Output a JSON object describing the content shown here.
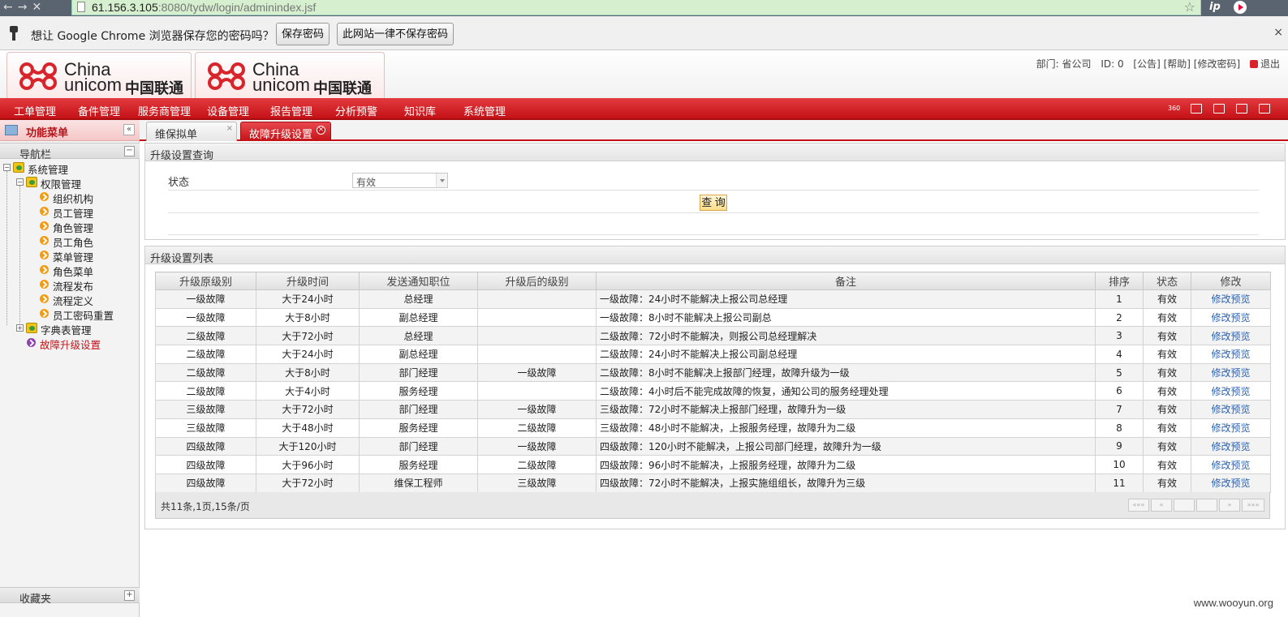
{
  "browser": {
    "url_host": "61.156.3.105",
    "url_rest": ":8080/tydw/login/adminindex.jsf",
    "ext_ip": "ip"
  },
  "infobar": {
    "message": "想让 Google Chrome 浏览器保存您的密码吗？",
    "save_label": "保存密码",
    "never_label": "此网站一律不保存密码",
    "close": "×"
  },
  "header": {
    "logo_en_1": "China",
    "logo_en_2": "unicom",
    "logo_cn": "中国联通",
    "dept": "部门: 省公司",
    "id": "ID: 0",
    "links": "[公告] [帮助] [修改密码]",
    "exit": "退出"
  },
  "menu": [
    "工单管理",
    "备件管理",
    "服务商管理",
    "设备管理",
    "报告管理",
    "分析预警",
    "知识库",
    "系统管理"
  ],
  "sidebar": {
    "title": "功能菜单",
    "collapse": "«",
    "nav_label": "导航栏",
    "nav_toggle": "−",
    "fav_label": "收藏夹",
    "fav_toggle": "+",
    "tree": {
      "root": "系统管理",
      "perm": "权限管理",
      "perm_items": [
        "组织机构",
        "员工管理",
        "角色管理",
        "员工角色",
        "菜单管理",
        "角色菜单",
        "流程发布",
        "流程定义",
        "员工密码重置"
      ],
      "dict": "字典表管理",
      "fault": "故障升级设置"
    }
  },
  "tabs": [
    {
      "label": "维保拟单",
      "close": "×"
    },
    {
      "label": "故障升级设置",
      "close": "×"
    }
  ],
  "query_panel": {
    "title": "升级设置查询",
    "status_label": "状态",
    "status_value": "有效",
    "query_button": "查 询"
  },
  "list_panel": {
    "title": "升级设置列表",
    "columns": [
      "升级原级别",
      "升级时间",
      "发送通知职位",
      "升级后的级别",
      "备注",
      "排序",
      "状态",
      "修改"
    ],
    "rows": [
      {
        "from": "一级故障",
        "time": "大于24小时",
        "notify": "总经理",
        "to": "",
        "note": "一级故障：24小时不能解决上报公司总经理",
        "order": "1",
        "status": "有效",
        "action": "修改预览"
      },
      {
        "from": "一级故障",
        "time": "大于8小时",
        "notify": "副总经理",
        "to": "",
        "note": "一级故障：8小时不能解决上报公司副总",
        "order": "2",
        "status": "有效",
        "action": "修改预览"
      },
      {
        "from": "二级故障",
        "time": "大于72小时",
        "notify": "总经理",
        "to": "",
        "note": "二级故障：72小时不能解决，则报公司总经理解决",
        "order": "3",
        "status": "有效",
        "action": "修改预览"
      },
      {
        "from": "二级故障",
        "time": "大于24小时",
        "notify": "副总经理",
        "to": "",
        "note": "二级故障：24小时不能解决上报公司副总经理",
        "order": "4",
        "status": "有效",
        "action": "修改预览"
      },
      {
        "from": "二级故障",
        "time": "大于8小时",
        "notify": "部门经理",
        "to": "一级故障",
        "note": "二级故障：8小时不能解决上报部门经理，故障升级为一级",
        "order": "5",
        "status": "有效",
        "action": "修改预览"
      },
      {
        "from": "二级故障",
        "time": "大于4小时",
        "notify": "服务经理",
        "to": "",
        "note": "二级故障：4小时后不能完成故障的恢复，通知公司的服务经理处理",
        "order": "6",
        "status": "有效",
        "action": "修改预览"
      },
      {
        "from": "三级故障",
        "time": "大于72小时",
        "notify": "部门经理",
        "to": "一级故障",
        "note": "三级故障：72小时不能解决上报部门经理，故障升为一级",
        "order": "7",
        "status": "有效",
        "action": "修改预览"
      },
      {
        "from": "三级故障",
        "time": "大于48小时",
        "notify": "服务经理",
        "to": "二级故障",
        "note": "三级故障：48小时不能解决，上报服务经理，故障升为二级",
        "order": "8",
        "status": "有效",
        "action": "修改预览"
      },
      {
        "from": "四级故障",
        "time": "大于120小时",
        "notify": "部门经理",
        "to": "一级故障",
        "note": "四级故障：120小时不能解决，上报公司部门经理，故障升为一级",
        "order": "9",
        "status": "有效",
        "action": "修改预览"
      },
      {
        "from": "四级故障",
        "time": "大于96小时",
        "notify": "服务经理",
        "to": "二级故障",
        "note": "四级故障：96小时不能解决，上报服务经理，故障升为二级",
        "order": "10",
        "status": "有效",
        "action": "修改预览"
      },
      {
        "from": "四级故障",
        "time": "大于72小时",
        "notify": "维保工程师",
        "to": "三级故障",
        "note": "四级故障：72小时不能解决，上报实施组组长，故障升为三级",
        "order": "11",
        "status": "有效",
        "action": "修改预览"
      }
    ],
    "summary": "共11条,1页,15条/页",
    "pager": [
      "«««",
      "«",
      "",
      "",
      "»",
      "»»»"
    ]
  },
  "watermark": "www.wooyun.org",
  "colors": {
    "brand_red": "#c41217",
    "link": "#2a62b5"
  }
}
